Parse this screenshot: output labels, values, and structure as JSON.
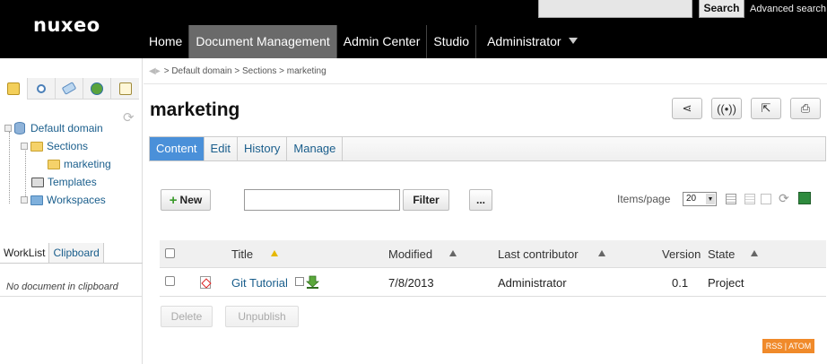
{
  "header": {
    "logo": "nuxeo",
    "search_button": "Search",
    "advanced_search": "Advanced search",
    "nav": [
      "Home",
      "Document Management",
      "Admin Center",
      "Studio"
    ],
    "user": "Administrator"
  },
  "sidebar": {
    "tree": {
      "root": "Default domain",
      "sections": "Sections",
      "marketing": "marketing",
      "templates": "Templates",
      "workspaces": "Workspaces"
    },
    "tabs": [
      "WorkList",
      "Clipboard"
    ],
    "empty_message": "No document in clipboard"
  },
  "breadcrumb": "> Default domain > Sections > marketing",
  "page": {
    "title": "marketing",
    "tabs": [
      "Content",
      "Edit",
      "History",
      "Manage"
    ]
  },
  "toolbar": {
    "new_label": "New",
    "filter_label": "Filter",
    "more_label": "...",
    "items_per_page_label": "Items/page",
    "items_per_page_value": "20"
  },
  "table": {
    "headers": {
      "title": "Title",
      "modified": "Modified",
      "contributor": "Last contributor",
      "version": "Version",
      "state": "State"
    },
    "rows": [
      {
        "title": "Git Tutorial",
        "modified": "7/8/2013",
        "contributor": "Administrator",
        "version": "0.1",
        "state": "Project"
      }
    ]
  },
  "bottom_actions": {
    "delete": "Delete",
    "unpublish": "Unpublish"
  },
  "feed": "RSS | ATOM",
  "colors": {
    "accent": "#4a90d9",
    "link": "#1a5e8c",
    "topbar": "#000000",
    "rss": "#f08a2a"
  }
}
